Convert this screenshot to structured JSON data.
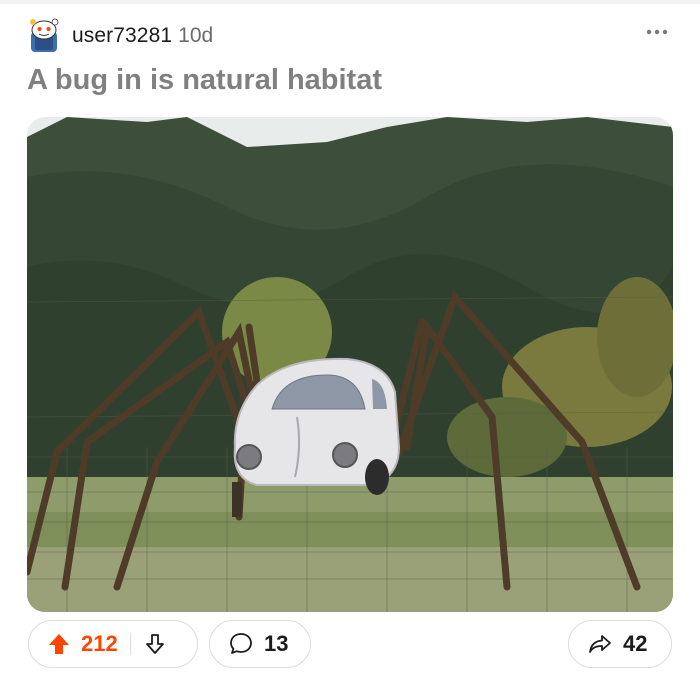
{
  "post": {
    "username": "user73281",
    "age": "10d",
    "more_icon": "more-horizontal-icon",
    "title": "A bug in is natural habitat"
  },
  "image": {
    "description_icon": "photo-icon"
  },
  "actions": {
    "upvotes": "212",
    "comments": "13",
    "shares": "42",
    "upvote_color": "#ff4500"
  }
}
